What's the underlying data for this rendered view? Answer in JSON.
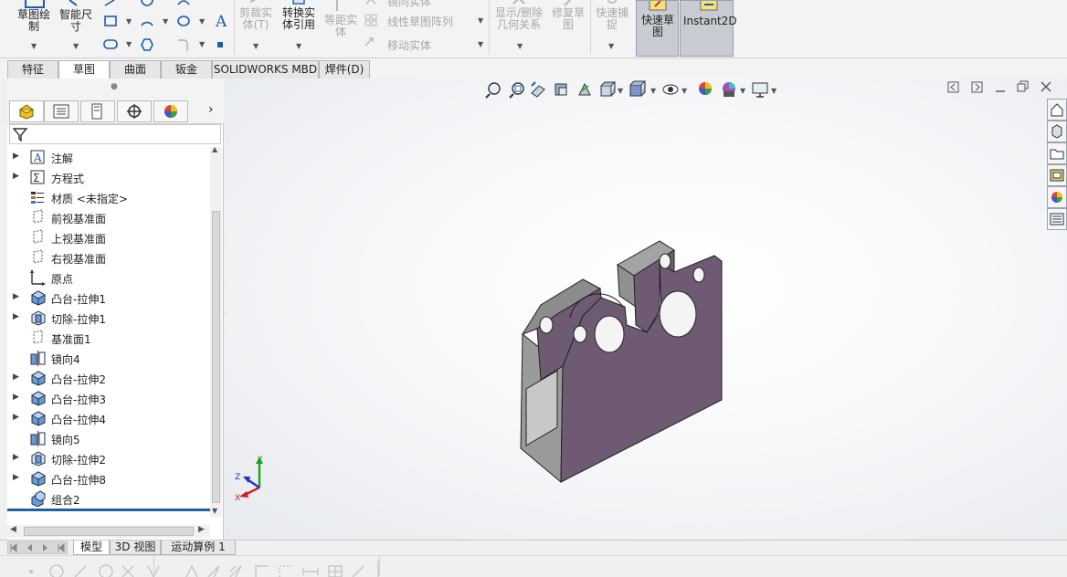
{
  "ribbon": {
    "sketch_label": "草图绘\n制",
    "smart_dim_label": "智能尺\n寸",
    "trim_label": "剪裁实\n体(T)",
    "convert_label": "转换实\n体引用",
    "offset_label": "等距实\n体",
    "mirror_label": "镜向实体",
    "linear_pattern_label": "线性草图阵列",
    "move_label": "移动实体",
    "relations_label": "显示/删除\n几何关系",
    "repair_label": "修复草\n图",
    "snap_label": "快速捕\n捉",
    "rapid_sketch_label": "快速草\n图",
    "instant2d_label": "Instant2D"
  },
  "command_tabs": [
    {
      "label": "特征"
    },
    {
      "label": "草图"
    },
    {
      "label": "曲面"
    },
    {
      "label": "钣金"
    },
    {
      "label": "SOLIDWORKS MBD"
    },
    {
      "label": "焊件(D)"
    }
  ],
  "tree": {
    "items": [
      {
        "label": "注解",
        "icon": "annotation-icon",
        "expandable": true
      },
      {
        "label": "方程式",
        "icon": "equation-icon",
        "expandable": true
      },
      {
        "label": "材质 <未指定>",
        "icon": "material-icon",
        "expandable": false
      },
      {
        "label": "前视基准面",
        "icon": "plane-icon",
        "expandable": false
      },
      {
        "label": "上视基准面",
        "icon": "plane-icon",
        "expandable": false
      },
      {
        "label": "右视基准面",
        "icon": "plane-icon",
        "expandable": false
      },
      {
        "label": "原点",
        "icon": "origin-icon",
        "expandable": false
      },
      {
        "label": "凸台-拉伸1",
        "icon": "boss-extrude-icon",
        "expandable": true
      },
      {
        "label": "切除-拉伸1",
        "icon": "cut-extrude-icon",
        "expandable": true
      },
      {
        "label": "基准面1",
        "icon": "plane-icon",
        "expandable": false
      },
      {
        "label": "镜向4",
        "icon": "mirror-icon",
        "expandable": false
      },
      {
        "label": "凸台-拉伸2",
        "icon": "boss-extrude-icon",
        "expandable": true
      },
      {
        "label": "凸台-拉伸3",
        "icon": "boss-extrude-icon",
        "expandable": true
      },
      {
        "label": "凸台-拉伸4",
        "icon": "boss-extrude-icon",
        "expandable": true
      },
      {
        "label": "镜向5",
        "icon": "mirror-icon",
        "expandable": false
      },
      {
        "label": "切除-拉伸2",
        "icon": "cut-extrude-icon",
        "expandable": true
      },
      {
        "label": "凸台-拉伸8",
        "icon": "boss-extrude-icon",
        "expandable": true
      },
      {
        "label": "组合2",
        "icon": "combine-icon",
        "expandable": false
      }
    ]
  },
  "triad": {
    "x": "X",
    "y": "Y",
    "z": "Z"
  },
  "bottom_tabs": [
    {
      "label": "模型"
    },
    {
      "label": "3D 视图"
    },
    {
      "label": "运动算例 1"
    }
  ],
  "colors": {
    "part_face": "#6e5a72",
    "part_side": "#9a9a9a",
    "accent": "#1f5fa8"
  }
}
